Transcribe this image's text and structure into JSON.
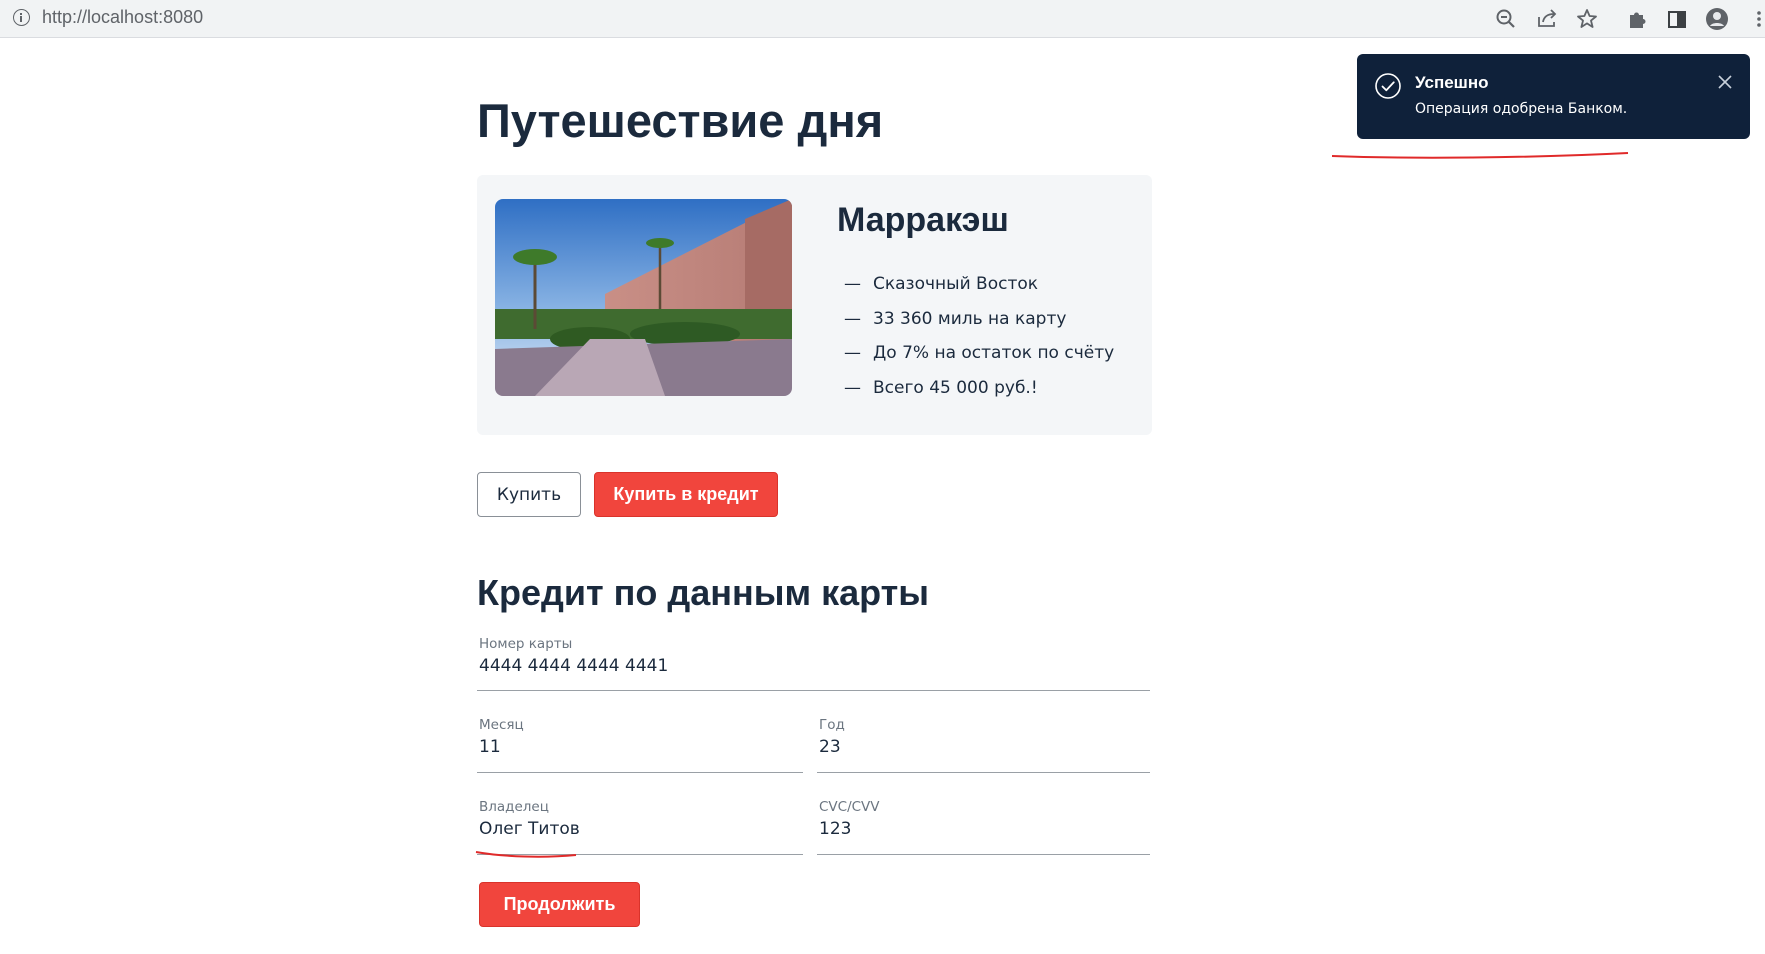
{
  "browser": {
    "url": "http://localhost:8080"
  },
  "main": {
    "title": "Путешествие дня",
    "card": {
      "city": "Марракэш",
      "features": [
        "Сказочный Восток",
        "33 360 миль на карту",
        "До 7% на остаток по счёту",
        "Всего 45 000 руб.!"
      ],
      "dash": "—"
    },
    "buttons": {
      "buy": "Купить",
      "buy_credit": "Купить в кредит"
    }
  },
  "form": {
    "title": "Кредит по данным карты",
    "card_number": {
      "label": "Номер карты",
      "value": "4444 4444 4444 4441"
    },
    "month": {
      "label": "Месяц",
      "value": "11"
    },
    "year": {
      "label": "Год",
      "value": "23"
    },
    "owner": {
      "label": "Владелец",
      "value": "Олег Титов"
    },
    "cvc": {
      "label": "CVC/CVV",
      "value": "123"
    },
    "continue": "Продолжить"
  },
  "notification": {
    "title": "Успешно",
    "message": "Операция одобрена Банком."
  },
  "colors": {
    "accent": "#f1453d",
    "text": "#1b2a3d",
    "toast_bg": "#0f213a",
    "card_bg": "#f4f6f8"
  }
}
